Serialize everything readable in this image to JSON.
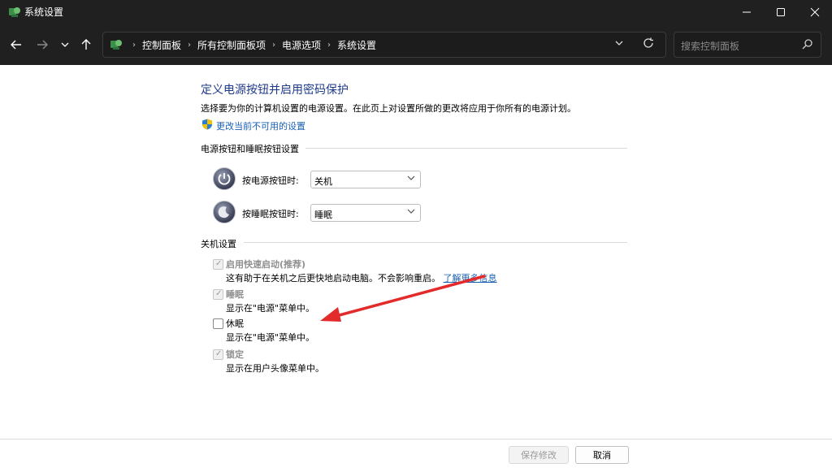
{
  "window": {
    "title": "系统设置",
    "minimize_icon": "minimize-icon",
    "maximize_icon": "maximize-icon",
    "close_icon": "close-icon"
  },
  "nav": {
    "breadcrumbs": [
      "控制面板",
      "所有控制面板项",
      "电源选项",
      "系统设置"
    ],
    "search_placeholder": "搜索控制面板"
  },
  "page": {
    "title": "定义电源按钮并启用密码保护",
    "description": "选择要为你的计算机设置的电源设置。在此页上对设置所做的更改将应用于你所有的电源计划。",
    "change_link": "更改当前不可用的设置"
  },
  "power_section": {
    "heading": "电源按钮和睡眠按钮设置",
    "power_button_label": "按电源按钮时:",
    "power_button_value": "关机",
    "sleep_button_label": "按睡眠按钮时:",
    "sleep_button_value": "睡眠"
  },
  "shutdown_section": {
    "heading": "关机设置",
    "items": [
      {
        "label": "启用快速启动(推荐)",
        "desc": "这有助于在关机之后更快地启动电脑。不会影响重启。",
        "link": "了解更多信息",
        "checked": true,
        "enabled": false
      },
      {
        "label": "睡眠",
        "desc": "显示在\"电源\"菜单中。",
        "checked": true,
        "enabled": false
      },
      {
        "label": "休眠",
        "desc": "显示在\"电源\"菜单中。",
        "checked": false,
        "enabled": true
      },
      {
        "label": "锁定",
        "desc": "显示在用户头像菜单中。",
        "checked": true,
        "enabled": false
      }
    ]
  },
  "buttons": {
    "save": "保存修改",
    "cancel": "取消"
  },
  "colors": {
    "titlebar": "#202020",
    "link": "#1a5fb4",
    "title": "#1e3a8a",
    "annotation_arrow": "#e32b2b"
  }
}
